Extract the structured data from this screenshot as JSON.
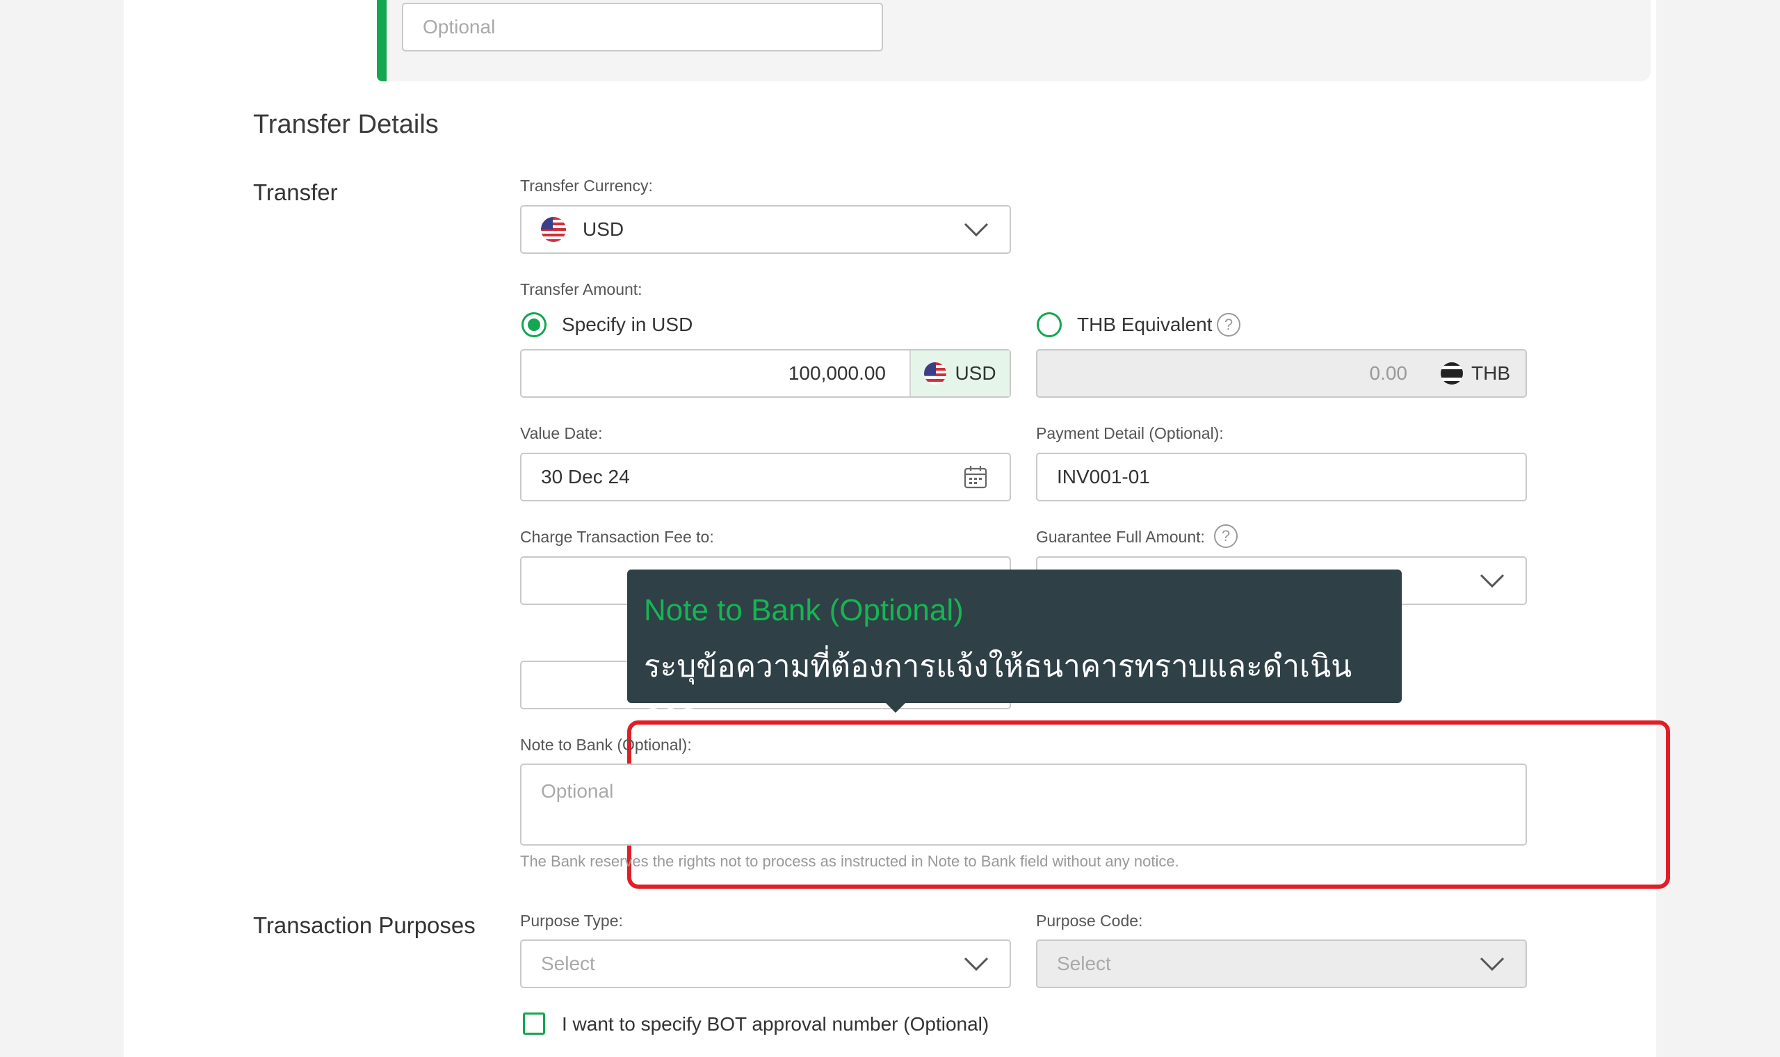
{
  "top": {
    "optional_placeholder": "Optional"
  },
  "section_title": "Transfer Details",
  "transfer": {
    "group_title": "Transfer",
    "currency_label": "Transfer Currency:",
    "currency_value": "USD",
    "amount_label": "Transfer Amount:",
    "specify_option": "Specify in USD",
    "thb_option": "THB Equivalent",
    "amount_value": "100,000.00",
    "amount_currency": "USD",
    "thb_value": "0.00",
    "thb_currency": "THB",
    "value_date_label": "Value Date:",
    "value_date": "30 Dec 24",
    "payment_detail_label": "Payment Detail (Optional):",
    "payment_detail": "INV001-01",
    "charge_fee_label": "Charge Transaction Fee to:",
    "guarantee_label": "Guarantee Full Amount:",
    "help_glyph": "?"
  },
  "tooltip": {
    "title": "Note to Bank (Optional)",
    "body": "ระบุข้อความที่ต้องการแจ้งให้ธนาคารทราบและดำเนินการ"
  },
  "note": {
    "label": "Note to Bank (Optional):",
    "placeholder": "Optional",
    "hint": "The Bank reserves the rights not to process as instructed in Note to Bank field without any notice."
  },
  "purposes": {
    "group_title": "Transaction Purposes",
    "type_label": "Purpose Type:",
    "type_placeholder": "Select",
    "code_label": "Purpose Code:",
    "code_placeholder": "Select",
    "bot_checkbox_label": "I want to specify BOT approval number (Optional)"
  },
  "icons": {
    "dropdown": "chevron-down-icon",
    "calendar": "calendar-icon",
    "help": "help-circle-icon",
    "flag_us": "us-flag-icon",
    "flag_th": "thai-flag-icon"
  },
  "colors": {
    "accent": "#14a651",
    "tooltip_bg": "#2f4047",
    "highlight": "#e01e25"
  }
}
